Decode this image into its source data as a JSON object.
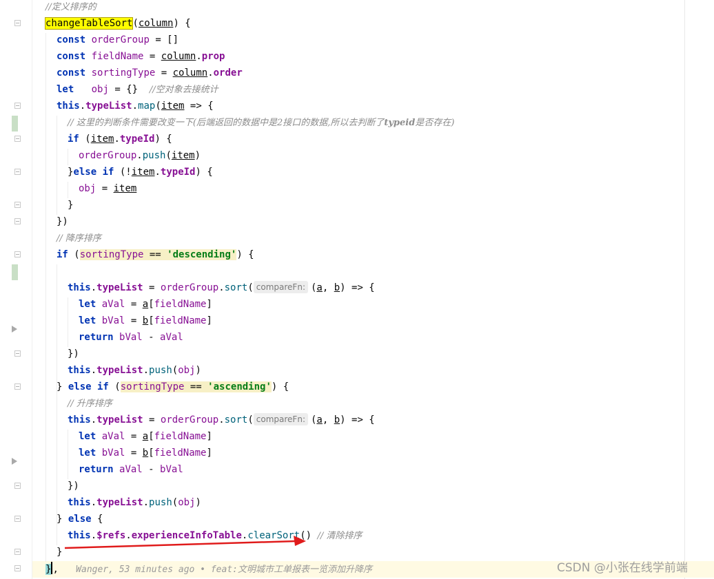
{
  "code": {
    "l0": {
      "comment": "//定义排序的"
    },
    "l1": {
      "name": "changeTableSort",
      "param": "column",
      "rest": ") {"
    },
    "l2": {
      "kw": "const",
      "var": "orderGroup",
      "rest": " = []"
    },
    "l3": {
      "kw": "const",
      "var": "fieldName",
      "eq": " = ",
      "obj": "column",
      "dot": ".",
      "prop": "prop"
    },
    "l4": {
      "kw": "const",
      "var": "sortingType",
      "eq": " = ",
      "obj": "column",
      "dot": ".",
      "prop": "order"
    },
    "l5": {
      "kw": "let",
      "var": "obj",
      "rest": " = {}  ",
      "comment": "//空对象去接统计"
    },
    "l6": {
      "kw": "this",
      "dot": ".",
      "prop": "typeList",
      "dot2": ".",
      "method": "map",
      "open": "(",
      "param": "item",
      "rest": " => {"
    },
    "l7": {
      "comment": "// 这里的判断条件需要改变一下(后端返回的数据中是2接口的数据,所以去判断了",
      "comment_bold": "typeid",
      "comment_tail": "是否存在)"
    },
    "l8": {
      "kw": "if",
      "open": " (",
      "obj": "item",
      "dot": ".",
      "prop": "typeId",
      "rest": ") {"
    },
    "l9": {
      "var": "orderGroup",
      "dot": ".",
      "method": "push",
      "open": "(",
      "arg": "item",
      "rest": ")"
    },
    "l10": {
      "pre": "}",
      "kw": "else if",
      "open": " (!",
      "obj": "item",
      "dot": ".",
      "prop": "typeId",
      "rest": ") {"
    },
    "l11": {
      "var": "obj",
      "eq": " = ",
      "arg": "item"
    },
    "l12": {
      "text": "}"
    },
    "l13": {
      "text": "})"
    },
    "l14": {
      "comment": "// 降序排序"
    },
    "l15": {
      "kw": "if",
      "open": " (",
      "var": "sortingType",
      "op": " == ",
      "str": "'descending'",
      "rest": ") {"
    },
    "l17": {
      "kw": "this",
      "dot": ".",
      "prop": "typeList",
      "eq": " = ",
      "var": "orderGroup",
      "dot2": ".",
      "method": "sort",
      "open": "(",
      "hint": "compareFn:",
      "a": "a",
      "comma": ", ",
      "b": "b",
      "rest": ") => {"
    },
    "l18": {
      "kw": "let",
      "var": "aVal",
      "eq": " = ",
      "obj": "a",
      "open": "[",
      "idx": "fieldName",
      "close": "]"
    },
    "l19": {
      "kw": "let",
      "var": "bVal",
      "eq": " = ",
      "obj": "b",
      "open": "[",
      "idx": "fieldName",
      "close": "]"
    },
    "l20": {
      "kw": "return",
      "v1": "bVal",
      "op": " - ",
      "v2": "aVal"
    },
    "l21": {
      "text": "})"
    },
    "l22": {
      "kw": "this",
      "dot": ".",
      "prop": "typeList",
      "dot2": ".",
      "method": "push",
      "open": "(",
      "arg": "obj",
      "rest": ")"
    },
    "l23": {
      "pre": "} ",
      "kw": "else if",
      "open": " (",
      "var": "sortingType",
      "op": " == ",
      "str": "'ascending'",
      "rest": ") {"
    },
    "l24": {
      "comment": "// 升序排序"
    },
    "l25": {
      "kw": "this",
      "dot": ".",
      "prop": "typeList",
      "eq": " = ",
      "var": "orderGroup",
      "dot2": ".",
      "method": "sort",
      "open": "(",
      "hint": "compareFn:",
      "a": "a",
      "comma": ", ",
      "b": "b",
      "rest": ") => {"
    },
    "l26": {
      "kw": "let",
      "var": "aVal",
      "eq": " = ",
      "obj": "a",
      "open": "[",
      "idx": "fieldName",
      "close": "]"
    },
    "l27": {
      "kw": "let",
      "var": "bVal",
      "eq": " = ",
      "obj": "b",
      "open": "[",
      "idx": "fieldName",
      "close": "]"
    },
    "l28": {
      "kw": "return",
      "v1": "aVal",
      "op": " - ",
      "v2": "bVal"
    },
    "l29": {
      "text": "})"
    },
    "l30": {
      "kw": "this",
      "dot": ".",
      "prop": "typeList",
      "dot2": ".",
      "method": "push",
      "open": "(",
      "arg": "obj",
      "rest": ")"
    },
    "l31": {
      "pre": "} ",
      "kw": "else",
      "rest": " {"
    },
    "l32": {
      "kw": "this",
      "dot": ".",
      "prop": "$refs",
      "dot2": ".",
      "prop2": "experienceInfoTable",
      "dot3": ".",
      "method": "clearSort",
      "rest": "() ",
      "comment": "// 清除排序"
    },
    "l33": {
      "text": "}"
    },
    "l34": {
      "text": "},"
    }
  },
  "blame": {
    "author_time": "Wanger, 53 minutes ago • ",
    "prefix": "feat:",
    "message": "文明城市工单报表一览添加升降序"
  },
  "watermark": "CSDN @小张在线学前端",
  "colors": {
    "keyword": "#0033b3",
    "property": "#871094",
    "string": "#067d17",
    "comment": "#8c8c8c",
    "function": "#00627a",
    "highlight": "#ffff00",
    "annotation_arrow": "#e01b1b"
  }
}
